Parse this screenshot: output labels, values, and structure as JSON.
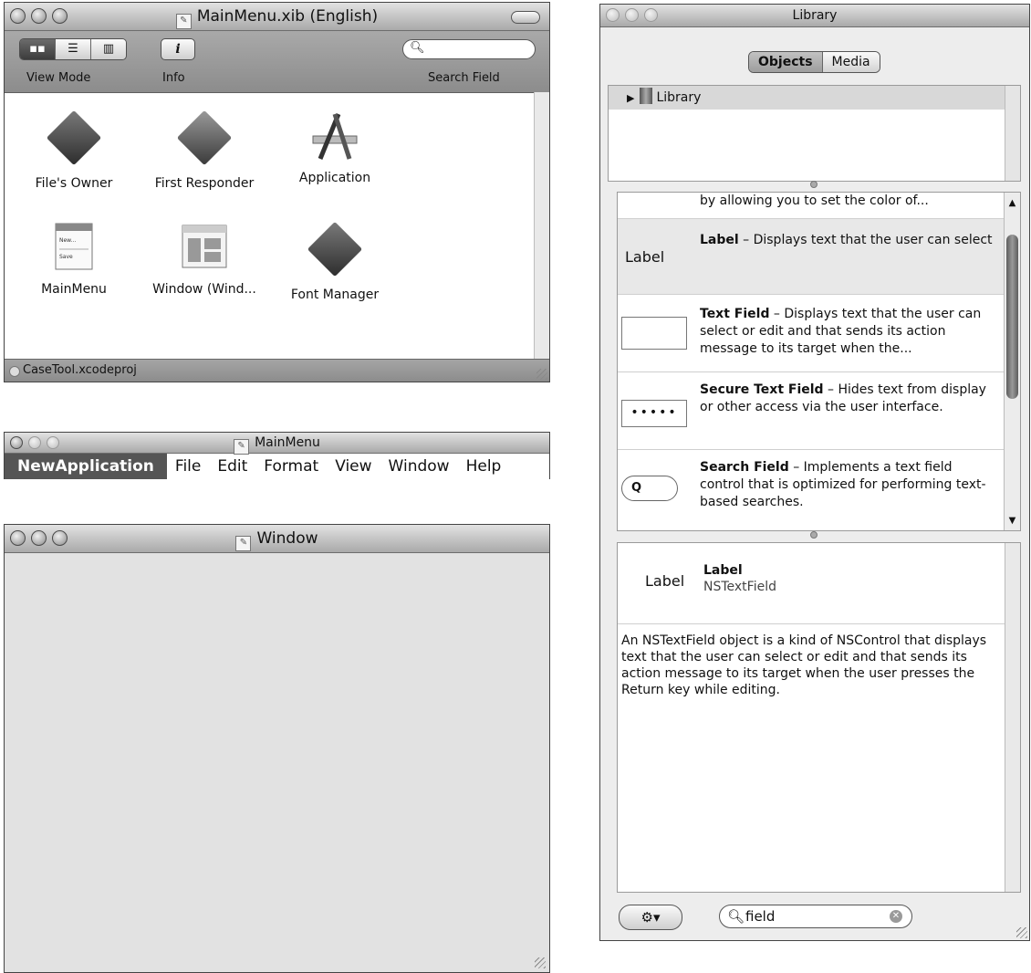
{
  "doc_window": {
    "title": "MainMenu.xib (English)",
    "toolbar": {
      "view_mode_label": "View Mode",
      "info_label": "Info",
      "search_label": "Search Field"
    },
    "objects": [
      {
        "label": "File's Owner",
        "icon": "cube-icon"
      },
      {
        "label": "First Responder",
        "icon": "cube-1-icon"
      },
      {
        "label": "Application",
        "icon": "application-icon"
      },
      {
        "label": "MainMenu",
        "icon": "menu-icon"
      },
      {
        "label": "Window (Wind...",
        "icon": "window-icon"
      },
      {
        "label": "Font Manager",
        "icon": "cube-icon"
      }
    ],
    "status": "CaseTool.xcodeproj"
  },
  "mainmenu_window": {
    "title": "MainMenu",
    "menu": [
      "NewApplication",
      "File",
      "Edit",
      "Format",
      "View",
      "Window",
      "Help"
    ]
  },
  "window_window": {
    "title": "Window"
  },
  "library": {
    "title": "Library",
    "tabs": [
      "Objects",
      "Media"
    ],
    "tree_root": "Library",
    "items": [
      {
        "name": "",
        "desc": "by allowing you to set the color of...",
        "icon_text": ""
      },
      {
        "name": "Label",
        "desc": " – Displays text that the user can select",
        "icon_text": "Label"
      },
      {
        "name": "Text Field",
        "desc": " – Displays text that the user can select or edit and that sends its action message to its target when the...",
        "icon_text": ""
      },
      {
        "name": "Secure Text Field",
        "desc": " – Hides text from display or other access via the user interface.",
        "icon_text": "•••••"
      },
      {
        "name": "Search Field",
        "desc": " – Implements a text field control that is optimized for performing text-based searches.",
        "icon_text": "Q"
      }
    ],
    "detail": {
      "icon_text": "Label",
      "name": "Label",
      "class": "NSTextField",
      "body": "An NSTextField object is a kind of NSControl that displays text that the user can select or edit and that sends its action message to its target when the user presses the Return key while editing."
    },
    "search_value": "field"
  }
}
